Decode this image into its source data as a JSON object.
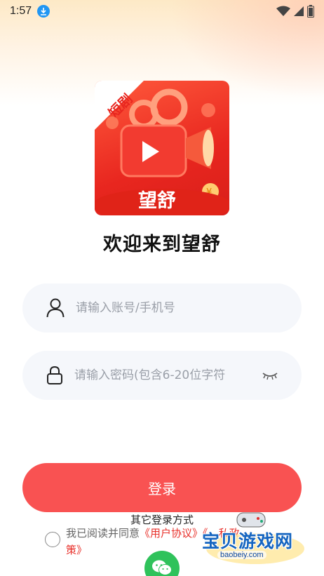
{
  "status_bar": {
    "time": "1:57",
    "icons": [
      "download-icon",
      "wifi-icon",
      "signal-icon",
      "battery-icon"
    ]
  },
  "logo": {
    "badge_text": "短剧",
    "brand_text": "望舒"
  },
  "welcome_title": "欢迎来到望舒",
  "account_input": {
    "placeholder": "请输入账号/手机号",
    "value": ""
  },
  "password_input": {
    "placeholder": "请输入密码(包含6-20位字符",
    "value": ""
  },
  "login_button": "登录",
  "other_login_label": "其它登录方式",
  "agreement": {
    "prefix": "我已阅读并同意",
    "user_agreement": "《用户协议》",
    "privacy_policy": "《隐私政策》",
    "privacy_visible_start": "《",
    "privacy_visible_end": "私政",
    "privacy_line2": "策》"
  },
  "watermark": {
    "title": "宝贝游戏网",
    "url": "baobeiy.com"
  },
  "colors": {
    "accent": "#f95252",
    "link": "#e8312b",
    "input_bg": "#f5f7fb",
    "wechat": "#2fc25b"
  }
}
